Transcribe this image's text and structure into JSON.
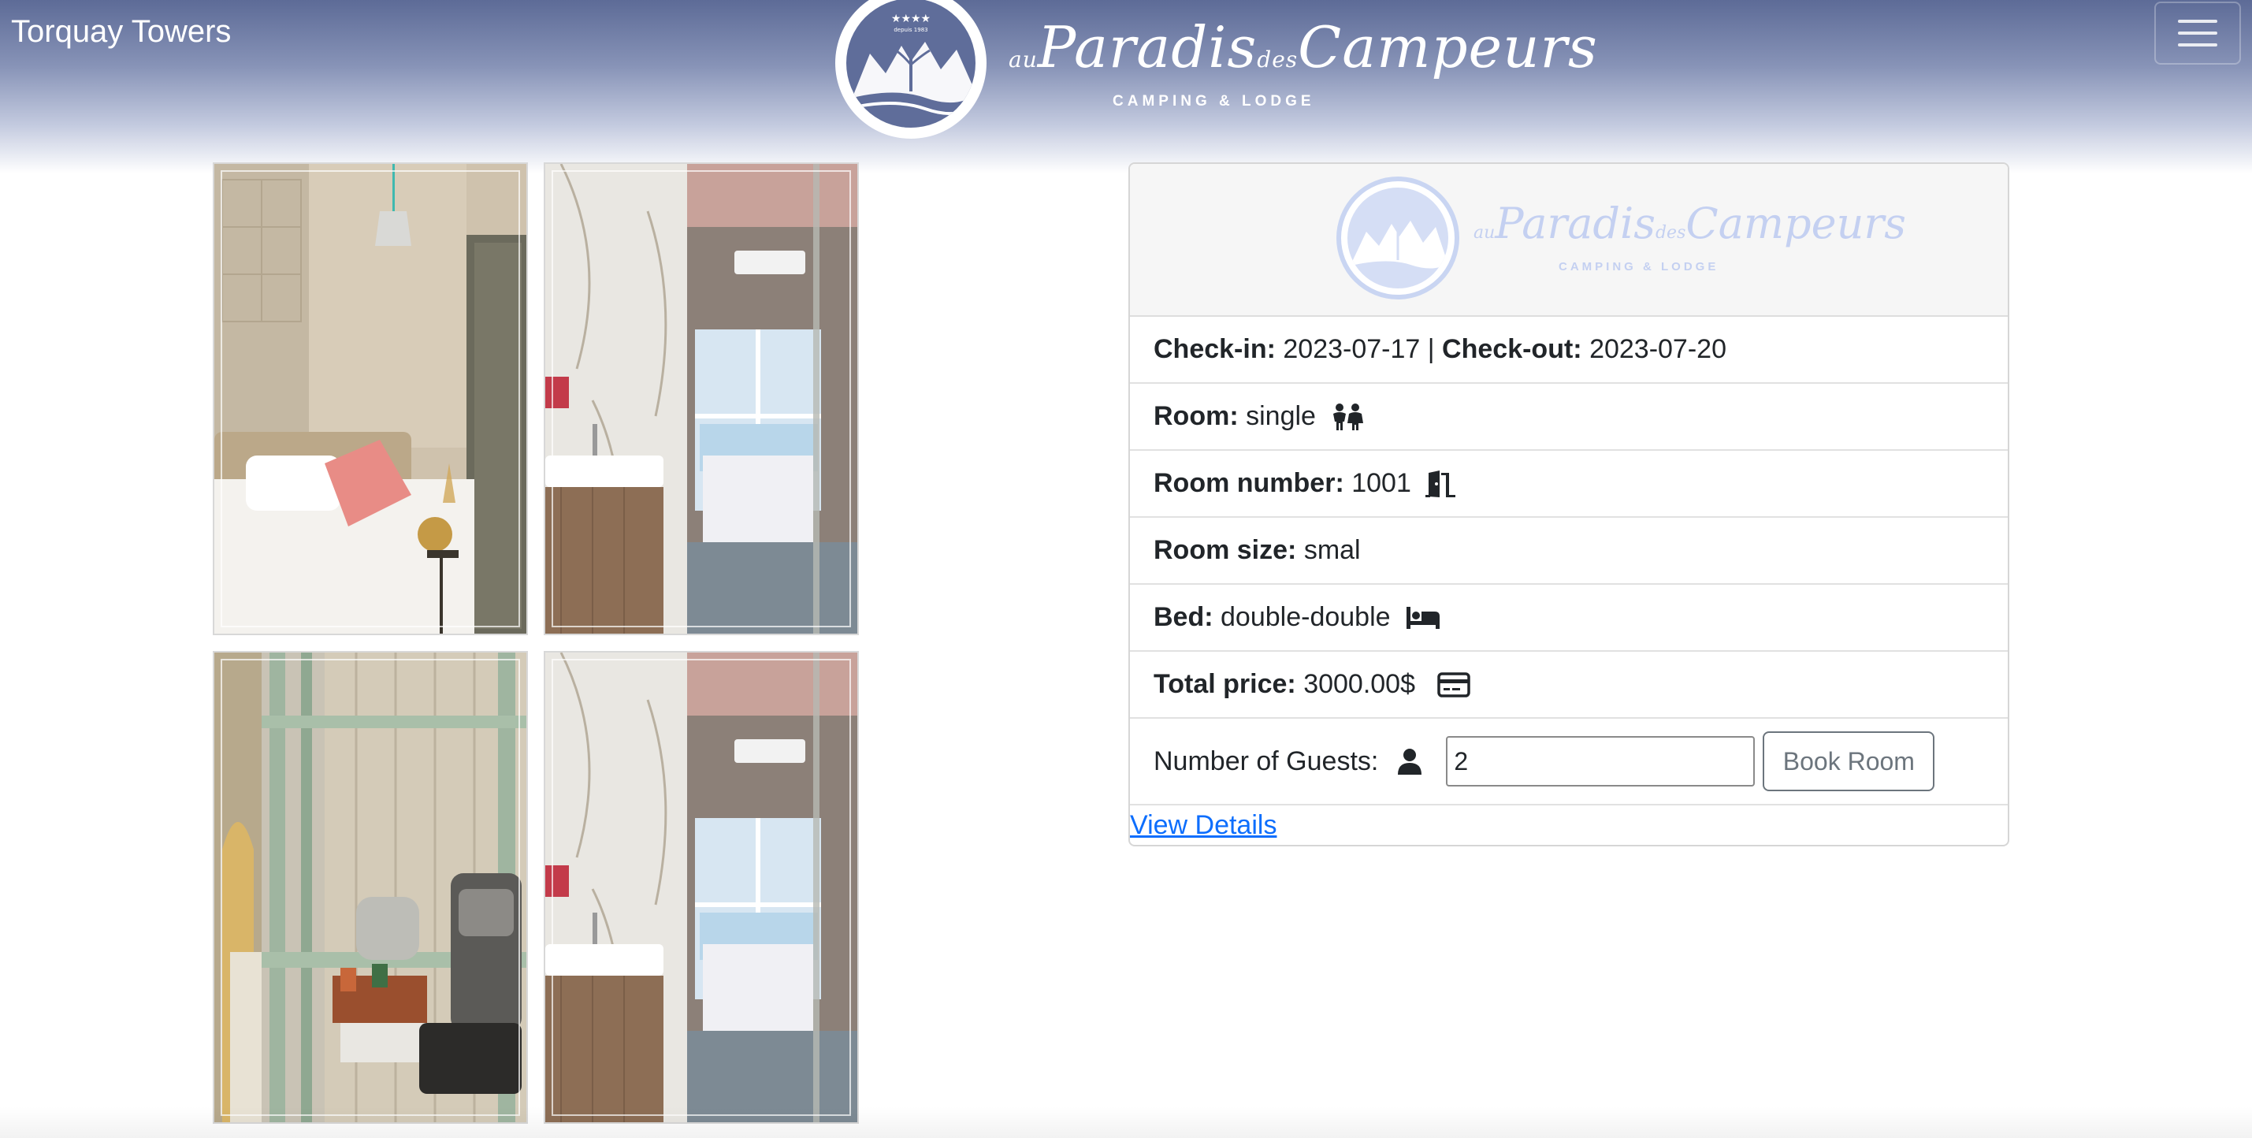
{
  "navbar": {
    "brand": "Torquay Towers",
    "logo": {
      "script": "Paradis",
      "prefix": "au",
      "middle": "des",
      "script2": "Campeurs",
      "tagline": "CAMPING & LODGE",
      "circle_text": "depuis 1983",
      "stars": "★★★★"
    },
    "toggler_icon": "hamburger-icon"
  },
  "gallery": {
    "photos": [
      {
        "subject": "bedroom with bed and pink pillow"
      },
      {
        "subject": "bathroom with sink and glass door"
      },
      {
        "subject": "metal shelf with coffee machine"
      },
      {
        "subject": "bathroom with sink and glass door"
      }
    ]
  },
  "card": {
    "header_logo": {
      "prefix": "au",
      "script": "Paradis",
      "middle": "des",
      "script2": "Campeurs",
      "tagline": "CAMPING & LODGE"
    },
    "checkin_label": "Check-in:",
    "checkin_value": "2023-07-17",
    "separator": "|",
    "checkout_label": "Check-out:",
    "checkout_value": "2023-07-20",
    "room_label": "Room:",
    "room_value": "single",
    "room_icon": "children-icon",
    "room_number_label": "Room number:",
    "room_number_value": "1001",
    "room_number_icon": "door-open-icon",
    "room_size_label": "Room size:",
    "room_size_value": "smal",
    "bed_label": "Bed:",
    "bed_value": "double-double",
    "bed_icon": "bed-icon",
    "price_label": "Total price:",
    "price_value": "3000.00$",
    "price_icon": "credit-card-icon",
    "guests_label": "Number of Guests:",
    "guests_icon": "user-icon",
    "guests_value": "2",
    "book_button": "Book Room",
    "details_link": "View Details"
  },
  "colors": {
    "header_top": "#5d6b97",
    "link": "#0d6efd",
    "button_border": "#6c757d"
  }
}
